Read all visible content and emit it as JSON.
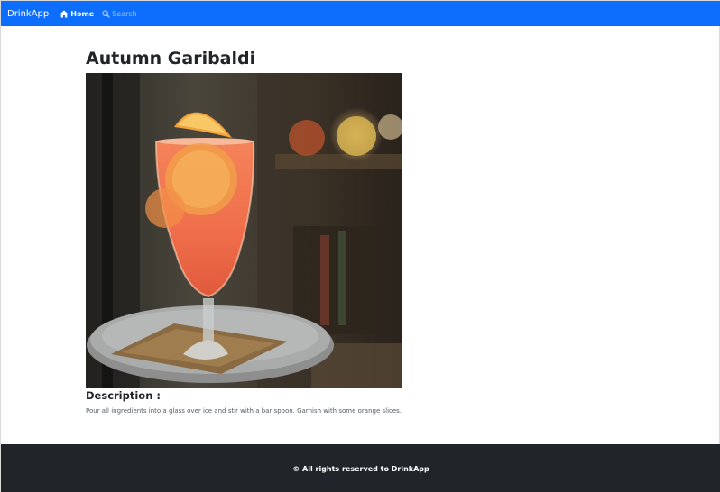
{
  "navbar": {
    "brand": "DrinkApp",
    "home_label": "Home",
    "search_label": "Search",
    "background": "#0d6efd",
    "icons": {
      "home": "home-icon",
      "search": "search-icon"
    }
  },
  "drink": {
    "title": "Autumn Garibaldi",
    "description_heading": "Description :",
    "description": "Pour all ingredients into a glass over ice and stir with a bar spoon. Garnish with some orange slices."
  },
  "footer": {
    "text": "© All rights reserved to DrinkApp",
    "background": "#212529"
  }
}
